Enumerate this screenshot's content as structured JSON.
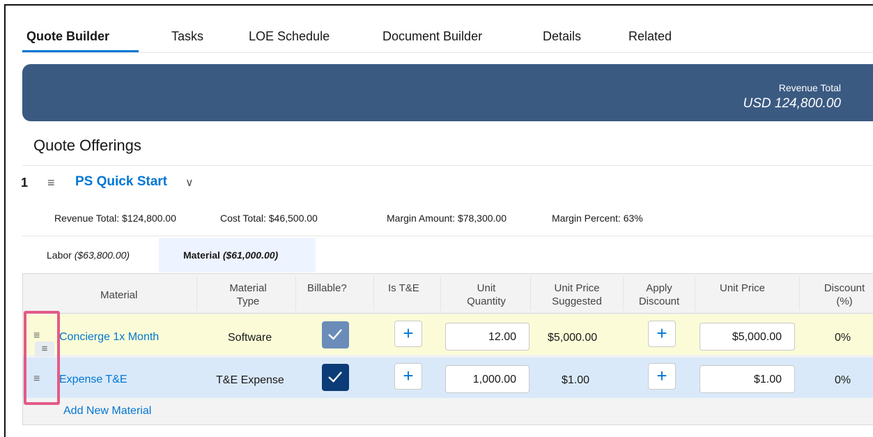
{
  "tabs": [
    {
      "label": "Quote Builder",
      "active": true
    },
    {
      "label": "Tasks"
    },
    {
      "label": "LOE Schedule"
    },
    {
      "label": "Document Builder"
    },
    {
      "label": "Details"
    },
    {
      "label": "Related"
    }
  ],
  "banner": {
    "label": "Revenue Total",
    "value": "USD 124,800.00",
    "color": "#3b5a82"
  },
  "section_title": "Quote Offerings",
  "offering": {
    "number": "1",
    "name": "PS Quick Start",
    "summary": {
      "revenue": "Revenue Total: $124,800.00",
      "cost": "Cost Total: $46,500.00",
      "margin_amount": "Margin Amount: $78,300.00",
      "margin_percent": "Margin Percent: 63%"
    },
    "subtabs": [
      {
        "label": "Labor",
        "amount": "($63,800.00)"
      },
      {
        "label": "Material",
        "amount": "($61,000.00)",
        "active": true
      }
    ]
  },
  "table": {
    "headers": {
      "material": "Material",
      "material_type_1": "Material",
      "material_type_2": "Type",
      "billable": "Billable?",
      "is_te": "Is T&E",
      "unit_qty_1": "Unit",
      "unit_qty_2": "Quantity",
      "ups_1": "Unit Price",
      "ups_2": "Suggested",
      "apply_1": "Apply",
      "apply_2": "Discount",
      "unit_price": "Unit Price",
      "discount_1": "Discount",
      "discount_2": "(%)"
    },
    "rows": [
      {
        "name": "Concierge 1x Month",
        "type": "Software",
        "billable": true,
        "quantity": "12.00",
        "suggested": "$5,000.00",
        "unit_price": "$5,000.00",
        "discount": "0%"
      },
      {
        "name": "Expense T&E",
        "type": "T&E Expense",
        "billable": true,
        "quantity": "1,000.00",
        "suggested": "$1.00",
        "unit_price": "$1.00",
        "discount": "0%"
      }
    ],
    "add_label": "Add New Material"
  },
  "colors": {
    "accent": "#0176d3",
    "row_highlight": "#fbfcd7",
    "row_selected": "#d9e9f9",
    "callout": "#e35b86"
  }
}
